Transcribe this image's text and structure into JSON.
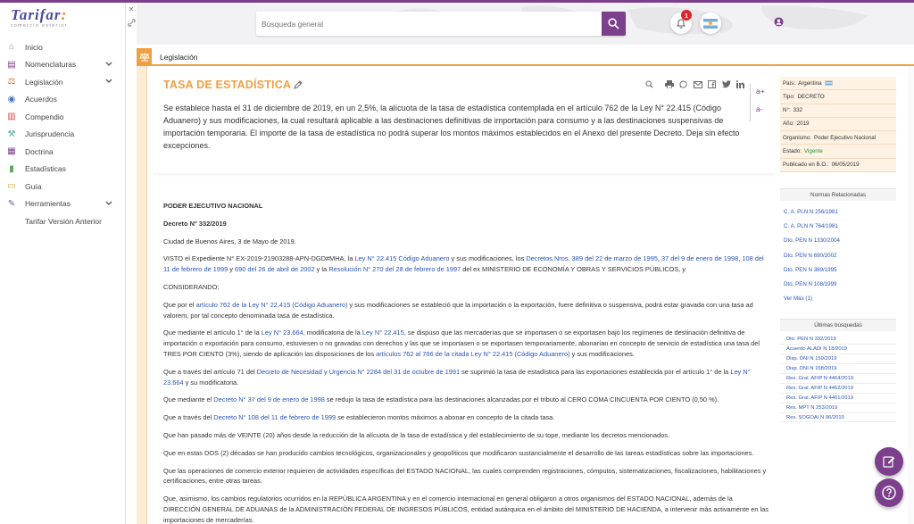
{
  "app": {
    "logo_text": "Tarifar",
    "logo_dot": ":",
    "logo_subtitle": "comercio exterior"
  },
  "sidebar": {
    "items": [
      {
        "label": "Inicio",
        "icon": "home-icon",
        "chevron": false
      },
      {
        "label": "Nomenclaturas",
        "icon": "book-icon",
        "chevron": true
      },
      {
        "label": "Legislación",
        "icon": "scale-icon",
        "chevron": true
      },
      {
        "label": "Acuerdos",
        "icon": "handshake-icon",
        "chevron": false
      },
      {
        "label": "Compendio",
        "icon": "books-icon",
        "chevron": false
      },
      {
        "label": "Jurisprudencia",
        "icon": "gavel-icon",
        "chevron": false
      },
      {
        "label": "Doctrina",
        "icon": "document-icon",
        "chevron": false
      },
      {
        "label": "Estadísticas",
        "icon": "bar-chart-icon",
        "chevron": false
      },
      {
        "label": "Guía",
        "icon": "guide-icon",
        "chevron": false
      },
      {
        "label": "Herramientas",
        "icon": "wrench-icon",
        "chevron": true
      },
      {
        "label": "Tarifar Versión Anterior",
        "icon": "",
        "chevron": false
      }
    ]
  },
  "header": {
    "search_placeholder": "Búsqueda general",
    "notification_count": "1"
  },
  "breadcrumb": {
    "label": "Legislación"
  },
  "document": {
    "title": "TASA DE ESTADÍSTICA",
    "summary": "Se establece hasta el 31 de diciembre de 2019, en un 2,5%, la alícuota de la tasa de estadística contemplada en el artículo 762 de la Ley N° 22.415 (Código Aduanero) y sus modificaciones, la cual resultará aplicable a las destinaciones definitivas de importación para consumo y a las destinaciones suspensivas de importación temporaria. El importe de la tasa de estadística no podrá superar los montos máximos establecidos en el Anexo del presente Decreto. Deja sin efecto excepciones.",
    "font_increase": "a+",
    "font_decrease": "a-",
    "body": {
      "issuer": "PODER EJECUTIVO NACIONAL",
      "decree": "Decreto N° 332/2019",
      "place_date": "Ciudad de Buenos Aires, 3 de Mayo de 2019.",
      "p_visto": [
        {
          "t": "VISTO el Expediente N° EX-2019-21903288-APN-DGD#MHA, la "
        },
        {
          "a": "Ley N° 22.415 Código Aduanero"
        },
        {
          "t": " y sus modificaciones, los "
        },
        {
          "a": "Decretos Nros. 389 del 22 de marzo de 1995"
        },
        {
          "t": ", "
        },
        {
          "a": "37 del 9 de enero de 1998"
        },
        {
          "t": ", "
        },
        {
          "a": "108 del 11 de febrero de 1999"
        },
        {
          "t": " y "
        },
        {
          "a": "690 del 26 de abril de 2002"
        },
        {
          "t": " y la "
        },
        {
          "a": "Resolución N° 270 del 28 de febrero de 1997"
        },
        {
          "t": " del ex MINISTERIO DE ECONOMÍA Y OBRAS Y SERVICIOS PÚBLICOS, y"
        }
      ],
      "considerando": "CONSIDERANDO:",
      "p1": [
        {
          "t": "Que por el "
        },
        {
          "a": "artículo 762 de la Ley N° 22.415 (Código Aduanero)"
        },
        {
          "t": " y sus modificaciones se estableció que la importación o la exportación, fuere definitiva o suspensiva, podrá estar gravada con una tasa ad valorem, por tal concepto denominada tasa de estadística."
        }
      ],
      "p2": [
        {
          "t": "Que mediante el artículo 1° de la "
        },
        {
          "a": "Ley N° 23.664"
        },
        {
          "t": ", modificatoria de la "
        },
        {
          "a": "Ley N° 22.415"
        },
        {
          "t": ", se dispuso que las mercaderías que se importasen o se exportasen bajo los regímenes de destinación definitiva de importación o exportación para consumo, estuviesen o no gravadas con derechos y las que se importasen o se exportasen temporariamente, abonarían en concepto de servicio de estadística una tasa del TRES POR CIENTO (3%), siendo de aplicación las disposiciones de los "
        },
        {
          "a": "artículos 762 al 766 de la citada Ley N° 22.415 (Código Aduanero)"
        },
        {
          "t": " y sus modificaciones."
        }
      ],
      "p3": [
        {
          "t": "Que a través del artículo 71 del "
        },
        {
          "a": "Decreto de Necesidad y Urgencia N° 2284 del 31 de octubre de 1991"
        },
        {
          "t": " se suprimió la tasa de estadística para las exportaciones establecida por el artículo 1° de la "
        },
        {
          "a": "Ley N° 23.664"
        },
        {
          "t": " y su modificatoria."
        }
      ],
      "p4": [
        {
          "t": "Que mediante el "
        },
        {
          "a": "Decreto N° 37 del 9 de enero de 1998"
        },
        {
          "t": " se redujo la tasa de estadística para las destinaciones alcanzadas por el tributo al CERO COMA CINCUENTA POR CIENTO (0,50 %)."
        }
      ],
      "p5": [
        {
          "t": "Que a través del "
        },
        {
          "a": "Decreto N° 108 del 11 de febrero de 1999"
        },
        {
          "t": " se establecieron montos máximos a abonar en concepto de la citada tasa."
        }
      ],
      "p6": "Que han pasado más de VEINTE (20) años desde la reducción de la alícuota de la tasa de estadística y del establecimiento de su tope, mediante los decretos mencionados.",
      "p7": "Que en estas DOS (2) décadas se han producido cambios tecnológicos, organizacionales y geopolíticos que modificaron sustancialmente el desarrollo de las tareas estadísticas sobre las importaciones.",
      "p8": "Que las operaciones de comercio exterior requieren de actividades específicas del ESTADO NACIONAL, las cuales comprenden registraciones, cómputos, sistematizaciones, fiscalizaciones, habilitaciones y certificaciones, entre otras tareas.",
      "p9": "Que, asimismo, los cambios regulatorios ocurridos en la REPÚBLICA ARGENTINA y en el comercio internacional en general obligaron a otros organismos del ESTADO NACIONAL, además de la DIRECCIÓN GENERAL DE ADUANAS de la ADMINISTRACIÓN FEDERAL DE INGRESOS PÚBLICOS, entidad autárquica en el ámbito del MINISTERIO DE HACIENDA, a intervenir más activamente en las importaciones de mercaderías."
    }
  },
  "meta": [
    {
      "k": "País:",
      "v": "Argentina",
      "flag": true
    },
    {
      "k": "Tipo:",
      "v": "DECRETO"
    },
    {
      "k": "N°:",
      "v": "332"
    },
    {
      "k": "Año:",
      "v": "2019"
    },
    {
      "k": "Organismo:",
      "v": "Poder Ejecutivo Nacional"
    },
    {
      "k": "Estado:",
      "v": "Vigente",
      "ok": true
    },
    {
      "k": "Publicado en B.O.:",
      "v": "06/05/2019"
    }
  ],
  "related": {
    "title": "Normas Relacionadas",
    "items": [
      "C. A. PLN N 256/1981",
      "C. A. PLN N 764/1981",
      "Dto. PEN N 1330/2004",
      "Dto. PEN N 690/2002",
      "Dto. PEN N 389/1995",
      "Dto. PEN N 108/1999",
      "Ver Más (1)"
    ]
  },
  "recent": {
    "title": "Últimas búsquedas",
    "items": [
      "Dto. PEN N 332/2019",
      "Acuerdo ALADI N 18/2019",
      "Disp. DNI N 159/2019",
      "Disp. DNI N 158/2019",
      "Res. Gral. AFIP N 4464/2019",
      "Res. Gral. AFIP N 4462/2019",
      "Res. Gral. AFIP N 4461/2019",
      "Res. MPT N 253/2019",
      "Res. SOGOAI N 96/2019"
    ]
  },
  "colors": {
    "brand_purple": "#7b3f8c",
    "accent_orange": "#f0a040",
    "link_blue": "#2a55b5"
  }
}
